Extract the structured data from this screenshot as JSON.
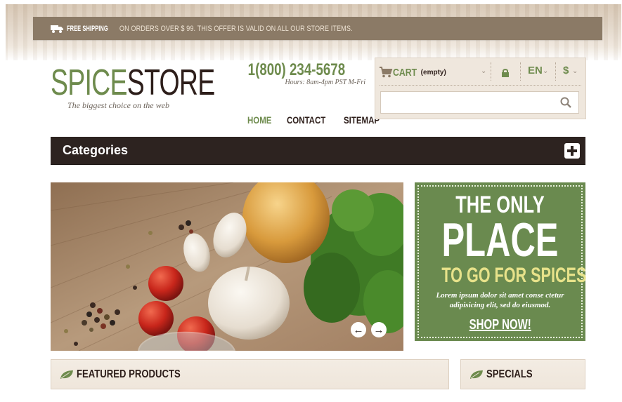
{
  "banner": {
    "strong": "FREE SHIPPING",
    "rest": "ON ORDERS OVER $ 99. THIS OFFER IS VALID ON ALL OUR STORE ITEMS."
  },
  "logo": {
    "part1": "SPICE",
    "part2": "STORE",
    "tagline": "The biggest choice on the web"
  },
  "contact": {
    "phone": "1(800) 234-5678",
    "hours": "Hours: 8am-4pm PST M-Fri"
  },
  "nav": {
    "items": [
      "HOME",
      "CONTACT",
      "SITEMAP"
    ],
    "active": "HOME"
  },
  "cart": {
    "label": "CART",
    "status": "(empty)",
    "language": "EN",
    "currency": "$"
  },
  "search": {
    "value": "",
    "placeholder": ""
  },
  "categories": {
    "label": "Categories"
  },
  "promo": {
    "line1": "THE ONLY",
    "line2": "PLACE",
    "line3": "TO GO FOR SPICES",
    "body": "Lorem ipsum dolor sit amet conse ctetur adipisicing elit, sed do eiusmod.",
    "cta": "SHOP NOW!"
  },
  "sections": {
    "featured": "FEATURED PRODUCTS",
    "specials": "SPECIALS"
  },
  "colors": {
    "accent_green": "#6e8b4d",
    "dark_brown": "#2d2320",
    "banner_brown": "#8b7a66",
    "promo_yellow": "#e7e28a"
  },
  "icons": {
    "banner": "truck-icon",
    "phone": "phone-icon",
    "cart": "cart-icon",
    "lock": "lock-icon",
    "search": "search-icon",
    "categories": "plus-icon",
    "section": "leaf-icon",
    "slider_prev": "arrow-left-icon",
    "slider_next": "arrow-right-icon"
  }
}
